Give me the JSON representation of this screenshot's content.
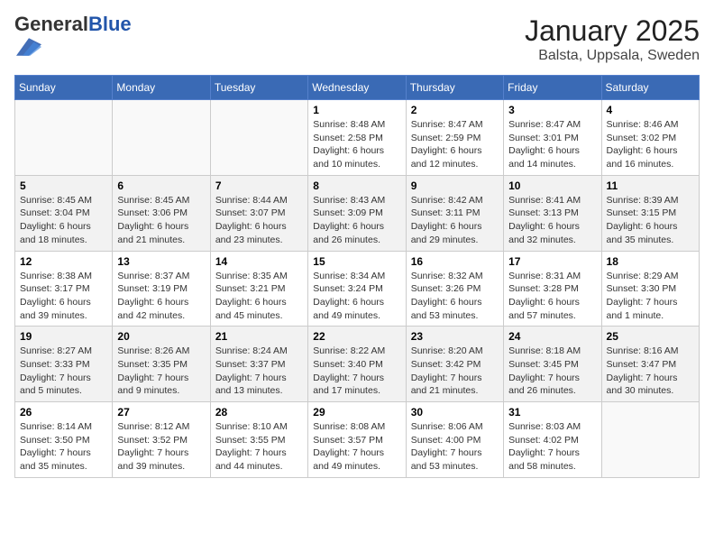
{
  "logo": {
    "general": "General",
    "blue": "Blue"
  },
  "title": "January 2025",
  "subtitle": "Balsta, Uppsala, Sweden",
  "weekdays": [
    "Sunday",
    "Monday",
    "Tuesday",
    "Wednesday",
    "Thursday",
    "Friday",
    "Saturday"
  ],
  "weeks": [
    [
      {
        "day": "",
        "info": ""
      },
      {
        "day": "",
        "info": ""
      },
      {
        "day": "",
        "info": ""
      },
      {
        "day": "1",
        "info": "Sunrise: 8:48 AM\nSunset: 2:58 PM\nDaylight: 6 hours\nand 10 minutes."
      },
      {
        "day": "2",
        "info": "Sunrise: 8:47 AM\nSunset: 2:59 PM\nDaylight: 6 hours\nand 12 minutes."
      },
      {
        "day": "3",
        "info": "Sunrise: 8:47 AM\nSunset: 3:01 PM\nDaylight: 6 hours\nand 14 minutes."
      },
      {
        "day": "4",
        "info": "Sunrise: 8:46 AM\nSunset: 3:02 PM\nDaylight: 6 hours\nand 16 minutes."
      }
    ],
    [
      {
        "day": "5",
        "info": "Sunrise: 8:45 AM\nSunset: 3:04 PM\nDaylight: 6 hours\nand 18 minutes."
      },
      {
        "day": "6",
        "info": "Sunrise: 8:45 AM\nSunset: 3:06 PM\nDaylight: 6 hours\nand 21 minutes."
      },
      {
        "day": "7",
        "info": "Sunrise: 8:44 AM\nSunset: 3:07 PM\nDaylight: 6 hours\nand 23 minutes."
      },
      {
        "day": "8",
        "info": "Sunrise: 8:43 AM\nSunset: 3:09 PM\nDaylight: 6 hours\nand 26 minutes."
      },
      {
        "day": "9",
        "info": "Sunrise: 8:42 AM\nSunset: 3:11 PM\nDaylight: 6 hours\nand 29 minutes."
      },
      {
        "day": "10",
        "info": "Sunrise: 8:41 AM\nSunset: 3:13 PM\nDaylight: 6 hours\nand 32 minutes."
      },
      {
        "day": "11",
        "info": "Sunrise: 8:39 AM\nSunset: 3:15 PM\nDaylight: 6 hours\nand 35 minutes."
      }
    ],
    [
      {
        "day": "12",
        "info": "Sunrise: 8:38 AM\nSunset: 3:17 PM\nDaylight: 6 hours\nand 39 minutes."
      },
      {
        "day": "13",
        "info": "Sunrise: 8:37 AM\nSunset: 3:19 PM\nDaylight: 6 hours\nand 42 minutes."
      },
      {
        "day": "14",
        "info": "Sunrise: 8:35 AM\nSunset: 3:21 PM\nDaylight: 6 hours\nand 45 minutes."
      },
      {
        "day": "15",
        "info": "Sunrise: 8:34 AM\nSunset: 3:24 PM\nDaylight: 6 hours\nand 49 minutes."
      },
      {
        "day": "16",
        "info": "Sunrise: 8:32 AM\nSunset: 3:26 PM\nDaylight: 6 hours\nand 53 minutes."
      },
      {
        "day": "17",
        "info": "Sunrise: 8:31 AM\nSunset: 3:28 PM\nDaylight: 6 hours\nand 57 minutes."
      },
      {
        "day": "18",
        "info": "Sunrise: 8:29 AM\nSunset: 3:30 PM\nDaylight: 7 hours\nand 1 minute."
      }
    ],
    [
      {
        "day": "19",
        "info": "Sunrise: 8:27 AM\nSunset: 3:33 PM\nDaylight: 7 hours\nand 5 minutes."
      },
      {
        "day": "20",
        "info": "Sunrise: 8:26 AM\nSunset: 3:35 PM\nDaylight: 7 hours\nand 9 minutes."
      },
      {
        "day": "21",
        "info": "Sunrise: 8:24 AM\nSunset: 3:37 PM\nDaylight: 7 hours\nand 13 minutes."
      },
      {
        "day": "22",
        "info": "Sunrise: 8:22 AM\nSunset: 3:40 PM\nDaylight: 7 hours\nand 17 minutes."
      },
      {
        "day": "23",
        "info": "Sunrise: 8:20 AM\nSunset: 3:42 PM\nDaylight: 7 hours\nand 21 minutes."
      },
      {
        "day": "24",
        "info": "Sunrise: 8:18 AM\nSunset: 3:45 PM\nDaylight: 7 hours\nand 26 minutes."
      },
      {
        "day": "25",
        "info": "Sunrise: 8:16 AM\nSunset: 3:47 PM\nDaylight: 7 hours\nand 30 minutes."
      }
    ],
    [
      {
        "day": "26",
        "info": "Sunrise: 8:14 AM\nSunset: 3:50 PM\nDaylight: 7 hours\nand 35 minutes."
      },
      {
        "day": "27",
        "info": "Sunrise: 8:12 AM\nSunset: 3:52 PM\nDaylight: 7 hours\nand 39 minutes."
      },
      {
        "day": "28",
        "info": "Sunrise: 8:10 AM\nSunset: 3:55 PM\nDaylight: 7 hours\nand 44 minutes."
      },
      {
        "day": "29",
        "info": "Sunrise: 8:08 AM\nSunset: 3:57 PM\nDaylight: 7 hours\nand 49 minutes."
      },
      {
        "day": "30",
        "info": "Sunrise: 8:06 AM\nSunset: 4:00 PM\nDaylight: 7 hours\nand 53 minutes."
      },
      {
        "day": "31",
        "info": "Sunrise: 8:03 AM\nSunset: 4:02 PM\nDaylight: 7 hours\nand 58 minutes."
      },
      {
        "day": "",
        "info": ""
      }
    ]
  ]
}
